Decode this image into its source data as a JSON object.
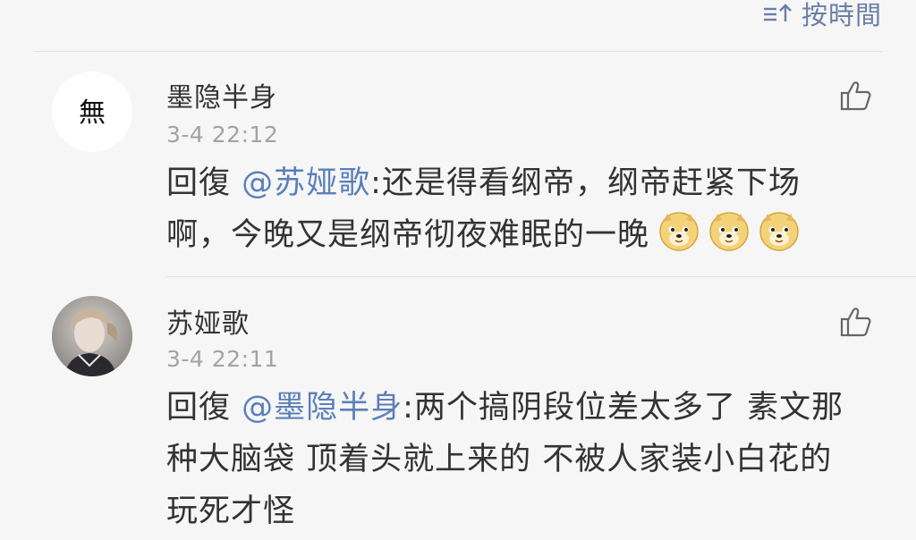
{
  "sort": {
    "label": "按時間",
    "icon": "sort-icon"
  },
  "comments": [
    {
      "avatar_icon": "ink-calligraphy-avatar",
      "avatar_text": "無",
      "username": "墨隐半身",
      "timestamp": "3-4 22:12",
      "reply_prefix": "回復",
      "mention": "@苏娅歌",
      "text": ":还是得看纲帝，纲帝赶紧下场啊，今晚又是纲帝彻夜难眠的一晚",
      "emojis": [
        "doge-emoji",
        "doge-emoji",
        "doge-emoji"
      ],
      "like_icon": "thumbs-up-icon"
    },
    {
      "avatar_icon": "user-photo-avatar",
      "username": "苏娅歌",
      "timestamp": "3-4 22:11",
      "reply_prefix": "回復",
      "mention": "@墨隐半身",
      "text": ":两个搞阴段位差太多了  素文那种大脑袋  顶着头就上来的  不被人家装小白花的玩死才怪",
      "like_icon": "thumbs-up-icon"
    }
  ],
  "colors": {
    "background": "#f6f6f6",
    "mention": "#5b7fba",
    "timestamp": "#a3a3a3",
    "accent": "#6a7fa6"
  }
}
